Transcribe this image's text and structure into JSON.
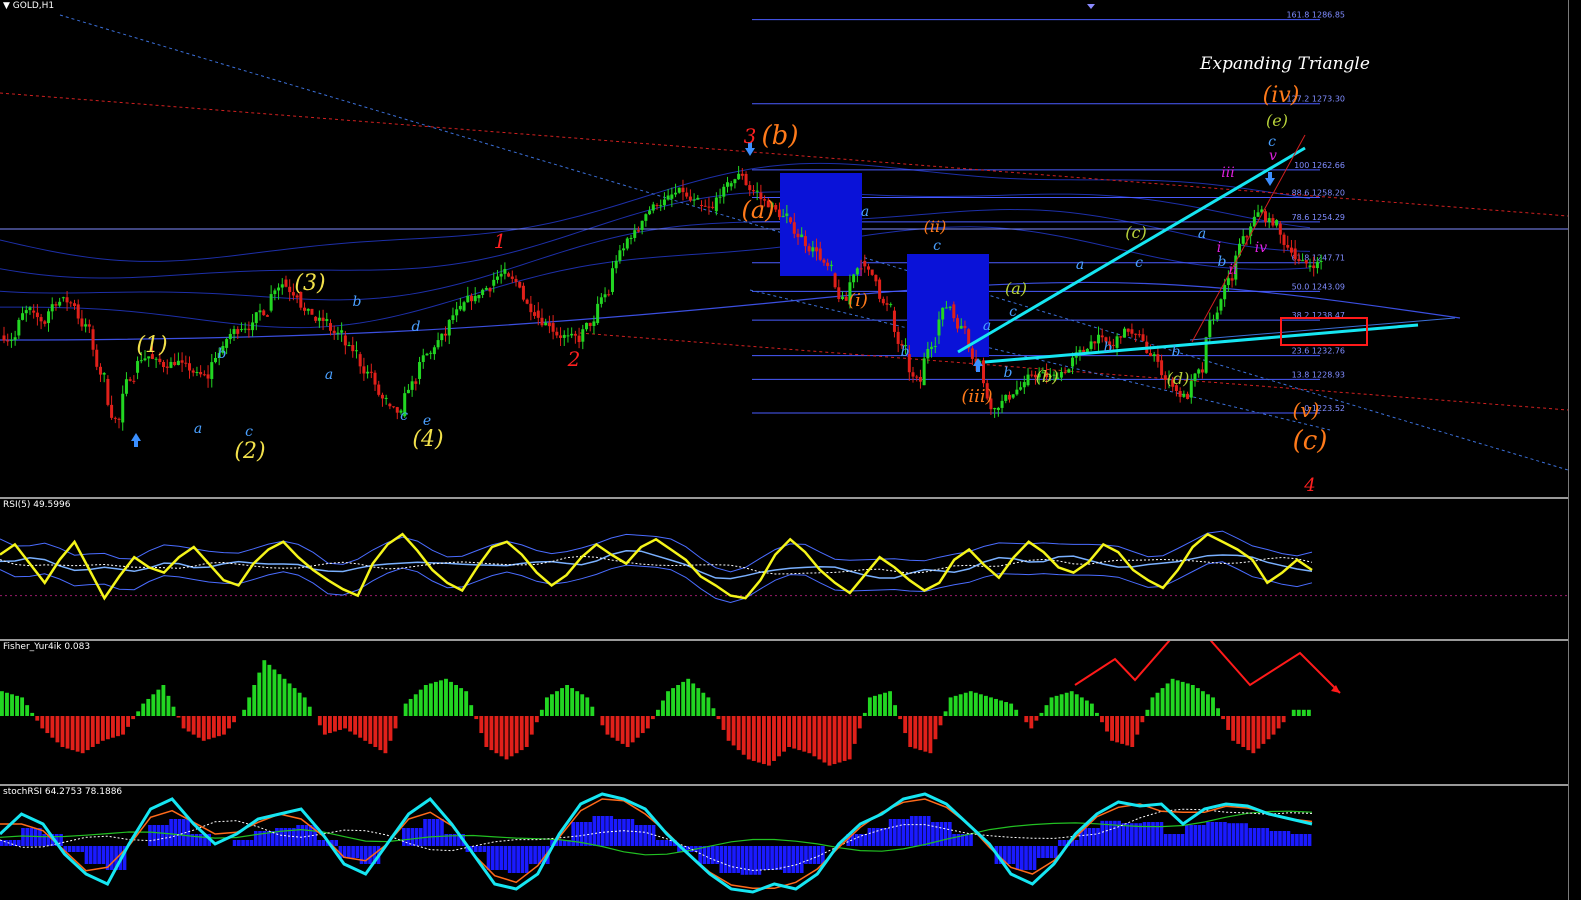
{
  "window": {
    "title": "GOLD,H1"
  },
  "main_chart": {
    "annotation_title": "Expanding Triangle",
    "fib_levels": [
      {
        "ratio": "161.8",
        "price": "1286.85"
      },
      {
        "ratio": "127.2",
        "price": "1273.30"
      },
      {
        "ratio": "100",
        "price": "1262.66"
      },
      {
        "ratio": "88.6",
        "price": "1258.20"
      },
      {
        "ratio": "78.6",
        "price": "1254.29"
      },
      {
        "ratio": "61.8",
        "price": "1247.71"
      },
      {
        "ratio": "50.0",
        "price": "1243.09"
      },
      {
        "ratio": "38.2",
        "price": "1238.47"
      },
      {
        "ratio": "23.6",
        "price": "1232.76"
      },
      {
        "ratio": "13.8",
        "price": "1228.93"
      },
      {
        "ratio": "0",
        "price": "1223.52"
      }
    ],
    "wave_labels": [
      {
        "text": "(1)",
        "color": "#f2e14b"
      },
      {
        "text": "(2)",
        "color": "#f2e14b"
      },
      {
        "text": "(3)",
        "color": "#f2e14b"
      },
      {
        "text": "(4)",
        "color": "#f2e14b"
      },
      {
        "text": "a",
        "color": "#4aa0ff"
      },
      {
        "text": "b",
        "color": "#4aa0ff"
      },
      {
        "text": "c",
        "color": "#4aa0ff"
      },
      {
        "text": "a",
        "color": "#4aa0ff"
      },
      {
        "text": "b",
        "color": "#4aa0ff"
      },
      {
        "text": "c",
        "color": "#4aa0ff"
      },
      {
        "text": "d",
        "color": "#4aa0ff"
      },
      {
        "text": "e",
        "color": "#4aa0ff"
      },
      {
        "text": "1",
        "color": "#ff2020"
      },
      {
        "text": "2",
        "color": "#ff2020"
      },
      {
        "text": "3",
        "color": "#ff2020"
      },
      {
        "text": "4",
        "color": "#ff2020"
      },
      {
        "text": "(a)",
        "color": "#ff7a1a"
      },
      {
        "text": "(b)",
        "color": "#ff7a1a"
      },
      {
        "text": "(c)",
        "color": "#ff7a1a"
      },
      {
        "text": "(i)",
        "color": "#ff7a1a"
      },
      {
        "text": "(ii)",
        "color": "#ff7a1a"
      },
      {
        "text": "(iii)",
        "color": "#ff7a1a"
      },
      {
        "text": "(iv)",
        "color": "#ff7a1a"
      },
      {
        "text": "(v)",
        "color": "#ff7a1a"
      },
      {
        "text": "a",
        "color": "#4aa0ff"
      },
      {
        "text": "b",
        "color": "#4aa0ff"
      },
      {
        "text": "c",
        "color": "#4aa0ff"
      },
      {
        "text": "(a)",
        "color": "#b8d23a"
      },
      {
        "text": "(b)",
        "color": "#b8d23a"
      },
      {
        "text": "(c)",
        "color": "#b8d23a"
      },
      {
        "text": "(d)",
        "color": "#b8d23a"
      },
      {
        "text": "(e)",
        "color": "#b8d23a"
      },
      {
        "text": "a",
        "color": "#4aa0ff"
      },
      {
        "text": "b",
        "color": "#4aa0ff"
      },
      {
        "text": "c",
        "color": "#4aa0ff"
      },
      {
        "text": "b",
        "color": "#4aa0ff"
      },
      {
        "text": "a",
        "color": "#4aa0ff"
      },
      {
        "text": "b",
        "color": "#4aa0ff"
      },
      {
        "text": "c",
        "color": "#4aa0ff"
      },
      {
        "text": "a",
        "color": "#4aa0ff"
      },
      {
        "text": "b",
        "color": "#4aa0ff"
      },
      {
        "text": "c",
        "color": "#4aa0ff"
      },
      {
        "text": "i",
        "color": "#e020e0"
      },
      {
        "text": "ii",
        "color": "#e020e0"
      },
      {
        "text": "iii",
        "color": "#e020e0"
      },
      {
        "text": "iv",
        "color": "#e020e0"
      },
      {
        "text": "v",
        "color": "#e020e0"
      }
    ]
  },
  "indicators": {
    "rsi": {
      "label": "RSI(5) 49.5996"
    },
    "fisher": {
      "label": "Fisher_Yur4ik 0.083"
    },
    "stochrsi": {
      "label": "stochRSI 64.2753 78.1886"
    }
  },
  "colors": {
    "bull": "#22d622",
    "bear": "#e0201a",
    "fib": "#4a5cff",
    "trendline": "#16e6f2",
    "rsi": "#f5f51a",
    "stoch": "#16e6f2",
    "hist": "#1a1aff"
  },
  "chart_data": [
    {
      "type": "candlestick",
      "title": "GOLD,H1",
      "xlabel": "",
      "ylabel": "",
      "ylim": [
        1210,
        1290
      ],
      "fib_retracement": {
        "ratios": [
          161.8,
          127.2,
          100,
          88.6,
          78.6,
          61.8,
          50.0,
          38.2,
          23.6,
          13.8,
          0
        ],
        "prices": [
          1286.85,
          1273.3,
          1262.66,
          1258.2,
          1254.29,
          1247.71,
          1243.09,
          1238.47,
          1232.76,
          1228.93,
          1223.52
        ]
      },
      "close_path": [
        1236,
        1240,
        1238,
        1242,
        1241,
        1237,
        1229,
        1222,
        1230,
        1233,
        1231,
        1232,
        1230,
        1229,
        1234,
        1237,
        1238,
        1240,
        1245,
        1243,
        1239,
        1238,
        1236,
        1233,
        1230,
        1225,
        1223,
        1229,
        1233,
        1236,
        1240,
        1242,
        1244,
        1246,
        1244,
        1240,
        1238,
        1236,
        1235,
        1238,
        1243,
        1250,
        1253,
        1257,
        1258,
        1259,
        1257,
        1256,
        1260,
        1262,
        1259,
        1257,
        1255,
        1252,
        1250,
        1246,
        1241,
        1248,
        1245,
        1240,
        1233,
        1228,
        1236,
        1241,
        1237,
        1232,
        1224,
        1226,
        1228,
        1230,
        1229,
        1231,
        1233,
        1236,
        1234,
        1237,
        1235,
        1232,
        1228,
        1226,
        1230,
        1240,
        1245,
        1252,
        1256,
        1254,
        1250,
        1247,
        1248
      ],
      "annotation": "Expanding Triangle"
    },
    {
      "type": "line",
      "title": "RSI(5) 49.5996",
      "ylim": [
        0,
        100
      ],
      "series": [
        {
          "values": [
            62,
            70,
            55,
            40,
            58,
            72,
            50,
            28,
            45,
            60,
            52,
            48,
            60,
            68,
            55,
            42,
            38,
            55,
            66,
            72,
            60,
            50,
            42,
            35,
            30,
            55,
            70,
            78,
            65,
            50,
            40,
            34,
            52,
            68,
            72,
            62,
            48,
            38,
            46,
            60,
            70,
            62,
            55,
            68,
            74,
            66,
            58,
            45,
            38,
            30,
            28,
            42,
            62,
            74,
            64,
            50,
            40,
            32,
            46,
            60,
            52,
            42,
            34,
            40,
            58,
            66,
            54,
            44,
            60,
            72,
            64,
            52,
            48,
            56,
            70,
            64,
            50,
            42,
            36,
            50,
            68,
            78,
            72,
            66,
            58,
            40,
            48,
            58,
            50
          ]
        }
      ]
    },
    {
      "type": "bar",
      "title": "Fisher_Yur4ik 0.083",
      "ylim": [
        -1,
        1
      ],
      "values": [
        0.4,
        0.3,
        -0.2,
        -0.5,
        -0.6,
        -0.4,
        -0.3,
        0.2,
        0.5,
        -0.2,
        -0.4,
        -0.3,
        0.1,
        0.9,
        0.6,
        0.3,
        -0.3,
        -0.2,
        -0.4,
        -0.6,
        0.2,
        0.5,
        0.6,
        0.4,
        -0.5,
        -0.7,
        -0.5,
        0.3,
        0.5,
        0.3,
        -0.3,
        -0.5,
        -0.2,
        0.4,
        0.6,
        0.3,
        -0.4,
        -0.7,
        -0.8,
        -0.5,
        -0.6,
        -0.8,
        -0.7,
        0.3,
        0.4,
        -0.5,
        -0.6,
        0.3,
        0.4,
        0.3,
        0.2,
        -0.2,
        0.3,
        0.4,
        0.2,
        -0.4,
        -0.5,
        0.3,
        0.6,
        0.5,
        0.3,
        -0.4,
        -0.6,
        -0.3,
        0.1
      ]
    },
    {
      "type": "line",
      "title": "stochRSI 64.2753 78.1886",
      "ylim": [
        0,
        100
      ],
      "series": [
        {
          "values": [
            60,
            80,
            70,
            40,
            20,
            10,
            50,
            85,
            95,
            70,
            50,
            60,
            75,
            80,
            85,
            60,
            30,
            20,
            50,
            80,
            95,
            70,
            40,
            10,
            5,
            20,
            60,
            90,
            100,
            95,
            85,
            60,
            40,
            20,
            5,
            2,
            10,
            5,
            20,
            50,
            70,
            80,
            95,
            100,
            90,
            70,
            50,
            20,
            10,
            30,
            60,
            80,
            92,
            88,
            90,
            70,
            85,
            90,
            88,
            80,
            75,
            70
          ]
        }
      ]
    }
  ]
}
